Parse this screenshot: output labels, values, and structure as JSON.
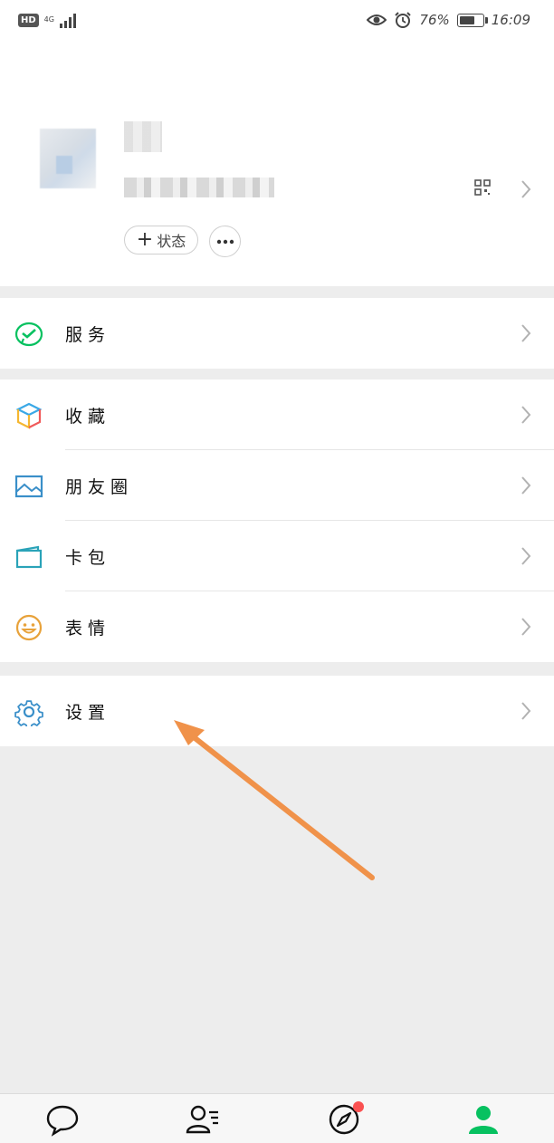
{
  "status_bar": {
    "hd": "HD",
    "network": "4G",
    "battery_percent": "76%",
    "battery_level": 0.76,
    "time": "16:09"
  },
  "profile": {
    "status_label": "状态",
    "status_plus": "+",
    "more_label": "•••"
  },
  "menu": {
    "services": "服务",
    "favorites": "收藏",
    "moments": "朋友圈",
    "card_wallet": "卡包",
    "stickers": "表情",
    "settings": "设置"
  },
  "colors": {
    "accent_green": "#07c160",
    "arrow_orange": "#f0924a",
    "badge_red": "#fa5151"
  },
  "icons": {
    "services": "wechat-pay-icon",
    "favorites": "cube-icon",
    "moments": "picture-icon",
    "card_wallet": "card-icon",
    "stickers": "smile-icon",
    "settings": "gear-icon"
  }
}
